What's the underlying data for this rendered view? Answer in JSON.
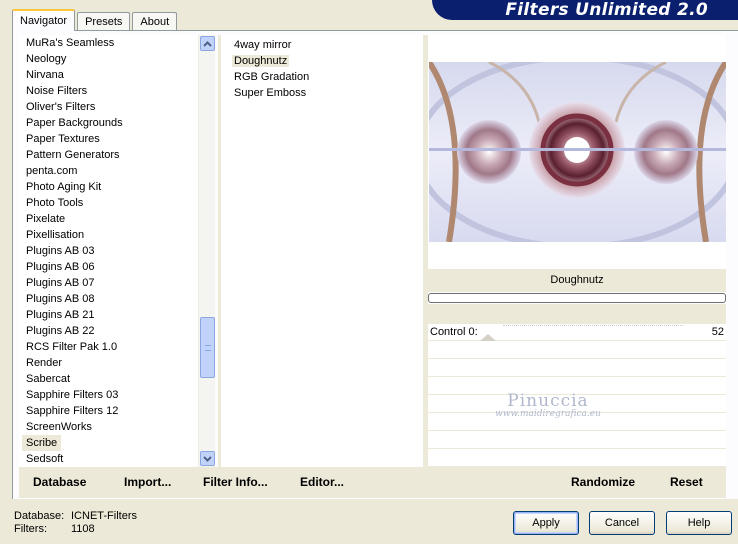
{
  "header": {
    "title": "Filters Unlimited 2.0"
  },
  "tabs": [
    {
      "label": "Navigator",
      "active": true
    },
    {
      "label": "Presets",
      "active": false
    },
    {
      "label": "About",
      "active": false
    }
  ],
  "categories": [
    "MuRa's Seamless",
    "Neology",
    "Nirvana",
    "Noise Filters",
    "Oliver's Filters",
    "Paper Backgrounds",
    "Paper Textures",
    "Pattern Generators",
    "penta.com",
    "Photo Aging Kit",
    "Photo Tools",
    "Pixelate",
    "Pixellisation",
    "Plugins AB 03",
    "Plugins AB 06",
    "Plugins AB 07",
    "Plugins AB 08",
    "Plugins AB 21",
    "Plugins AB 22",
    "RCS Filter Pak 1.0",
    "Render",
    "Sabercat",
    "Sapphire Filters 03",
    "Sapphire Filters 12",
    "ScreenWorks",
    "Scribe",
    "Sedsoft"
  ],
  "selected_category": "Scribe",
  "filters": [
    "4way mirror",
    "Doughnutz",
    "RGB Gradation",
    "Super Emboss"
  ],
  "selected_filter": "Doughnutz",
  "preview": {
    "filter_name": "Doughnutz"
  },
  "control": {
    "label": "Control 0:",
    "value": "52"
  },
  "watermark": {
    "name": "Pinuccia",
    "url": "www.maidiregrafica.eu"
  },
  "bottom_links": {
    "database": "Database",
    "import": "Import...",
    "filter_info": "Filter Info...",
    "editor": "Editor...",
    "randomize": "Randomize",
    "reset": "Reset"
  },
  "status": {
    "database_label": "Database:",
    "database_value": "ICNET-Filters",
    "filters_label": "Filters:",
    "filters_value": "1108"
  },
  "buttons": {
    "apply": "Apply",
    "cancel": "Cancel",
    "help": "Help"
  },
  "colors": {
    "banner": "#0a1f6e",
    "tab_highlight": "#ffc83c",
    "panel_bg": "#ece9d8"
  }
}
